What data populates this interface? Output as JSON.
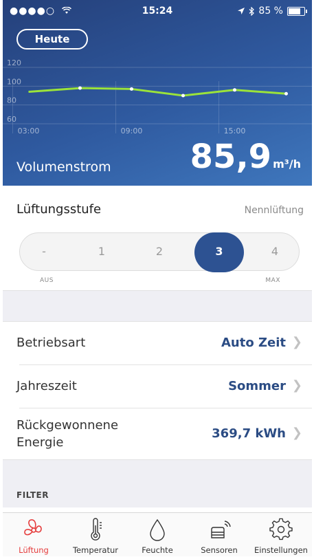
{
  "status_bar": {
    "signal": "●●●●○",
    "time": "15:24",
    "battery_text": "85 %"
  },
  "header": {
    "today_button": "Heute",
    "metric_label": "Volumenstrom",
    "metric_value": "85,9",
    "metric_unit": "m³/h"
  },
  "chart_data": {
    "type": "line",
    "x_tick_labels": [
      "03:00",
      "09:00",
      "15:00"
    ],
    "y_tick_labels": [
      "120",
      "100",
      "80",
      "60"
    ],
    "ylim": [
      60,
      120
    ],
    "x": [
      0,
      6,
      12,
      18,
      24,
      30
    ],
    "values": [
      94,
      98,
      97,
      90,
      96,
      92
    ],
    "x_domain": [
      -3,
      33
    ],
    "line_color": "#9be33a"
  },
  "fan_level": {
    "title": "Lüftungsstufe",
    "mode_label": "Nennlüftung",
    "steps": [
      "-",
      "1",
      "2",
      "3",
      "4"
    ],
    "selected": "3",
    "min_label": "AUS",
    "max_label": "MAX"
  },
  "settings": [
    {
      "label": "Betriebsart",
      "value": "Auto Zeit"
    },
    {
      "label": "Jahreszeit",
      "value": "Sommer"
    },
    {
      "label_line1": "Rückgewonnene",
      "label_line2": "Energie",
      "value": "369,7 kWh"
    }
  ],
  "section_filter": "FILTER",
  "tabs": [
    {
      "label": "Lüftung",
      "icon": "fan-icon",
      "active": true
    },
    {
      "label": "Temperatur",
      "icon": "thermometer-icon",
      "active": false
    },
    {
      "label": "Feuchte",
      "icon": "drop-icon",
      "active": false
    },
    {
      "label": "Sensoren",
      "icon": "sensor-icon",
      "active": false
    },
    {
      "label": "Einstellungen",
      "icon": "gear-icon",
      "active": false
    }
  ],
  "colors": {
    "accent": "#2d5292",
    "tab_active": "#e53c3c",
    "value_text": "#2b4c84"
  }
}
